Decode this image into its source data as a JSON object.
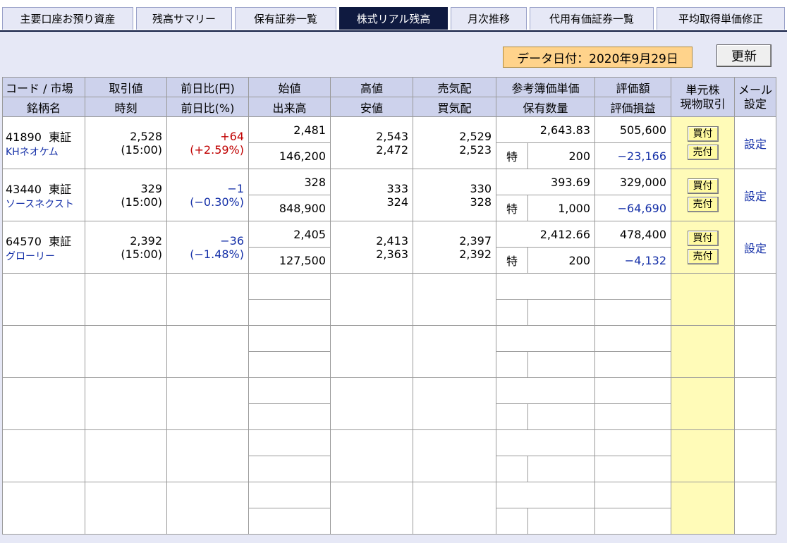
{
  "tabs": [
    {
      "label": "主要口座お預り資産"
    },
    {
      "label": "残高サマリー"
    },
    {
      "label": "保有証券一覧"
    },
    {
      "label": "株式リアル残高"
    },
    {
      "label": "月次推移"
    },
    {
      "label": "代用有価証券一覧"
    },
    {
      "label": "平均取得単価修正"
    }
  ],
  "data_date": "データ日付：2020年9月29日",
  "refresh_label": "更新",
  "headers": {
    "code_market": "コード / 市場",
    "name": "銘柄名",
    "price": "取引値",
    "time": "時刻",
    "change_yen": "前日比(円)",
    "change_pct": "前日比(%)",
    "open": "始値",
    "volume": "出来高",
    "high": "高値",
    "low": "安値",
    "ask": "売気配",
    "bid": "買気配",
    "ref_cost": "参考簿価単価",
    "holdings": "保有数量",
    "valuation": "評価額",
    "pl": "評価損益",
    "unit_trade_1": "単元株",
    "unit_trade_2": "現物取引",
    "mail_1": "メール",
    "mail_2": "設定"
  },
  "rows": [
    {
      "code": "41890",
      "market": "東証",
      "name": "KHネオケム",
      "price": "2,528",
      "time": "(15:00)",
      "change": "+64",
      "change_pct": "(+2.59%)",
      "open": "2,481",
      "volume": "146,200",
      "high": "2,543",
      "low": "2,472",
      "ask": "2,529",
      "bid": "2,523",
      "ref_cost": "2,643.83",
      "account": "特",
      "qty": "200",
      "valuation": "505,600",
      "pl": "−23,166",
      "buy": "買付",
      "sell": "売付",
      "setting": "設定"
    },
    {
      "code": "43440",
      "market": "東証",
      "name": "ソースネクスト",
      "price": "329",
      "time": "(15:00)",
      "change": "−1",
      "change_pct": "(−0.30%)",
      "open": "328",
      "volume": "848,900",
      "high": "333",
      "low": "324",
      "ask": "330",
      "bid": "328",
      "ref_cost": "393.69",
      "account": "特",
      "qty": "1,000",
      "valuation": "329,000",
      "pl": "−64,690",
      "buy": "買付",
      "sell": "売付",
      "setting": "設定"
    },
    {
      "code": "64570",
      "market": "東証",
      "name": "グローリー",
      "price": "2,392",
      "time": "(15:00)",
      "change": "−36",
      "change_pct": "(−1.48%)",
      "open": "2,405",
      "volume": "127,500",
      "high": "2,413",
      "low": "2,363",
      "ask": "2,397",
      "bid": "2,392",
      "ref_cost": "2,412.66",
      "account": "特",
      "qty": "200",
      "valuation": "478,400",
      "pl": "−4,132",
      "buy": "買付",
      "sell": "売付",
      "setting": "設定"
    }
  ],
  "colors": {
    "header_bg": "#cdd2ec",
    "active_tab": "#0f1a40",
    "date_bg": "#ffd38b",
    "trade_col_bg": "#fffbb8",
    "positive": "#c00000",
    "negative": "#1530a8"
  }
}
